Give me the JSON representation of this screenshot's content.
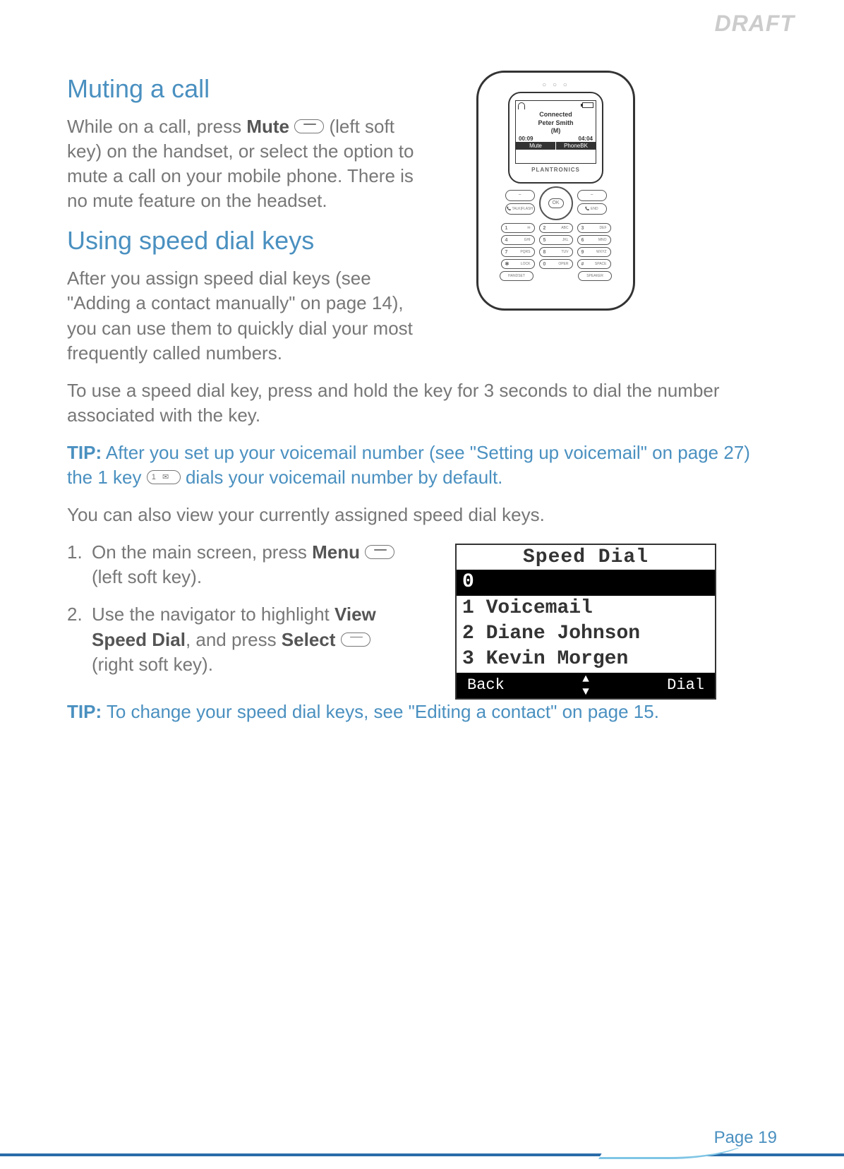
{
  "watermark": "DRAFT",
  "sections": {
    "muting": {
      "heading": "Muting a call",
      "body": "While on a call, press Mute [key] (left soft key) on the handset, or select the option to mute a call on your mobile phone. There is no mute feature on the headset.",
      "body_pre": "While on a call, press ",
      "body_bold1": "Mute",
      "body_mid": " (left soft key) on the handset, or select the option to mute a call on your mobile phone. There is no mute feature on the headset."
    },
    "speed": {
      "heading": "Using speed dial keys",
      "p1_pre": "After you assign speed dial keys (see \"Adding a contact manually\" on page 14), you can use them to quickly dial your most frequently called numbers.",
      "p2": "To use a speed dial key, press and hold the key for 3 seconds to dial the number associated with the key.",
      "tip1_label": "TIP:",
      "tip1_pre": " After you set up your voicemail number (see \"Setting up voicemail\" on page 27) the 1 key ",
      "tip1_post": " dials your voicemail number by default.",
      "p3": "You can also view your currently assigned speed dial keys.",
      "step1_pre": "On the main screen, press ",
      "step1_bold": "Menu",
      "step1_post": " (left soft key).",
      "step2_pre": "Use the navigator to highlight ",
      "step2_bold1": "View Speed Dial",
      "step2_mid": ", and press ",
      "step2_bold2": "Select",
      "step2_post": " (right soft key).",
      "tip2_label": "TIP:",
      "tip2": " To change your speed dial keys, see \"Editing a contact\" on page 15."
    }
  },
  "phone": {
    "brand": "PLANTRONICS",
    "screen": {
      "line1": "Connected",
      "line2": "Peter Smith",
      "line3": "(M)",
      "time_left": "00:09",
      "time_right": "04:04",
      "softkey_left": "Mute",
      "softkey_right": "PhoneBK"
    },
    "ok_label": "OK",
    "left_soft_upper": "−",
    "left_soft_lower_l": "TALK",
    "left_soft_lower_r": "FLASH",
    "right_soft_upper": "−",
    "right_soft_lower": "END",
    "keypad": [
      {
        "num": "1",
        "label": "✉"
      },
      {
        "num": "2",
        "label": "ABC"
      },
      {
        "num": "3",
        "label": "DEF"
      },
      {
        "num": "4",
        "label": "GHI"
      },
      {
        "num": "5",
        "label": "JKL"
      },
      {
        "num": "6",
        "label": "MNO"
      },
      {
        "num": "7",
        "label": "PQRS"
      },
      {
        "num": "8",
        "label": "TUV"
      },
      {
        "num": "9",
        "label": "WXYZ"
      },
      {
        "num": "✱",
        "label": "LOCK"
      },
      {
        "num": "0",
        "label": "OPER"
      },
      {
        "num": "#",
        "label": "SPACE"
      }
    ],
    "bottom_left": "HANDSET",
    "bottom_right": "SPEAKER"
  },
  "speed_dial": {
    "title": "Speed Dial",
    "entries": [
      {
        "num": "0",
        "name": ""
      },
      {
        "num": "1",
        "name": "Voicemail"
      },
      {
        "num": "2",
        "name": "Diane Johnson"
      },
      {
        "num": "3",
        "name": "Kevin Morgen"
      }
    ],
    "softkey_left": "Back",
    "softkey_right": "Dial"
  },
  "footer": {
    "page": "Page 19"
  }
}
